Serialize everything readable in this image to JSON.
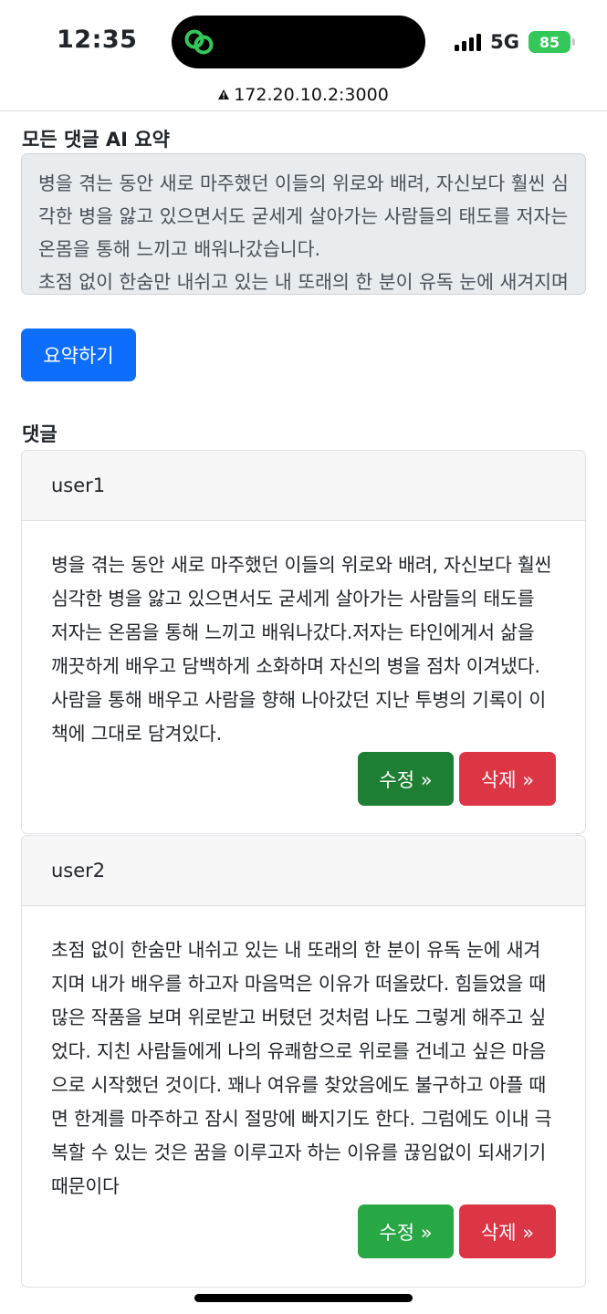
{
  "status_bar": {
    "time": "12:35",
    "network": "5G",
    "battery": "85"
  },
  "browser": {
    "url": "172.20.10.2:3000"
  },
  "summary": {
    "title": "모든 댓글 AI 요약",
    "text": "병을 겪는 동안 새로 마주했던 이들의 위로와 배려, 자신보다 훨씬 심각한 병을 앓고 있으면서도 굳세게 살아가는 사람들의 태도를 저자는 온몸을 통해 느끼고 배워나갔습니다.\n초점 없이 한숨만 내쉬고 있는 내 또래의 한 분이 유독 눈에 새겨지며",
    "button_label": "요약하기"
  },
  "comments": {
    "title": "댓글",
    "items": [
      {
        "user": "user1",
        "text": "병을 겪는 동안 새로 마주했던 이들의 위로와 배려, 자신보다 훨씬 심각한 병을 앓고 있으면서도 굳세게 살아가는 사람들의 태도를 저자는 온몸을 통해 느끼고 배워나갔다.저자는 타인에게서 삶을 깨끗하게 배우고 담백하게 소화하며 자신의 병을 점차 이겨냈다. 사람을 통해 배우고 사람을 향해 나아갔던 지난 투병의 기록이 이 책에 그대로 담겨있다.",
        "edit_label": "수정 »",
        "delete_label": "삭제 »"
      },
      {
        "user": "user2",
        "text": "초점 없이 한숨만 내쉬고 있는 내 또래의 한 분이 유독 눈에 새겨지며 내가 배우를 하고자 마음먹은 이유가 떠올랐다. 힘들었을 때 많은 작품을 보며 위로받고 버텼던 것처럼 나도 그렇게 해주고 싶었다. 지친 사람들에게 나의 유쾌함으로 위로를 건네고 싶은 마음으로 시작했던 것이다. 꽤나 여유를 찾았음에도 불구하고 아플 때면 한계를 마주하고 잠시 절망에 빠지기도 한다. 그럼에도 이내 극복할 수 있는 것은 꿈을 이루고자 하는 이유를 끊임없이 되새기기 때문이다",
        "edit_label": "수정 »",
        "delete_label": "삭제 »"
      }
    ]
  },
  "colors": {
    "primary": "#0d6efd",
    "edit_active": "#1e7e34",
    "edit": "#28a745",
    "delete": "#dc3545",
    "battery": "#34c759"
  }
}
